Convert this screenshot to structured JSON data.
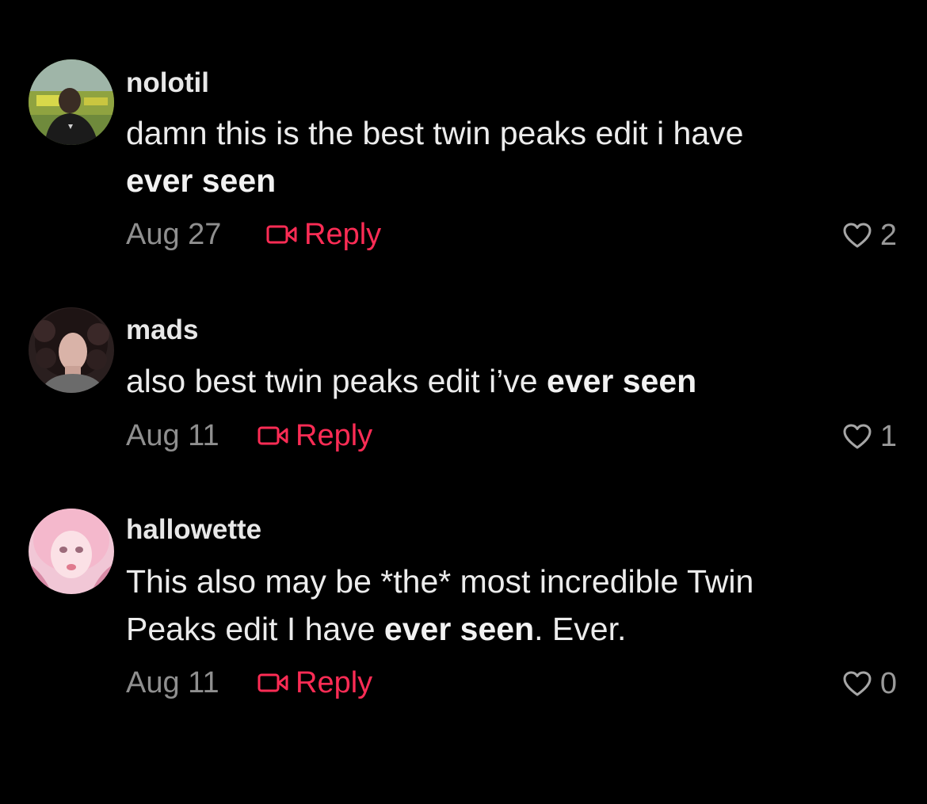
{
  "comments": [
    {
      "username": "nolotil",
      "body_line1": "damn this is the best twin peaks edit i have",
      "body_bold1": "ever seen",
      "date": "Aug 27",
      "reply_label": "Reply",
      "likes": "2"
    },
    {
      "username": "mads",
      "body_text1": "also best twin peaks edit i’ve ",
      "body_bold1": "ever seen",
      "date": "Aug 11",
      "reply_label": "Reply",
      "likes": "1"
    },
    {
      "username": "hallowette",
      "body_line1": "This also may be *the* most incredible Twin",
      "body_text2": "Peaks edit I have ",
      "body_bold2": "ever seen",
      "body_text3": ". Ever.",
      "date": "Aug 11",
      "reply_label": "Reply",
      "likes": "0"
    }
  ],
  "colors": {
    "background": "#000000",
    "accent": "#fe2c55",
    "muted": "#8f8f8f"
  },
  "icons": [
    "video-reply-icon",
    "heart-outline-icon"
  ]
}
